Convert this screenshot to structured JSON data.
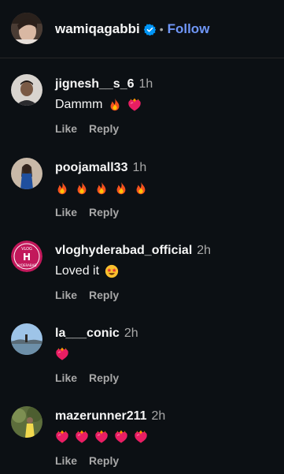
{
  "header": {
    "username": "wamiqagabbi",
    "separator": "•",
    "follow_label": "Follow",
    "verified_icon": "verified-badge-icon",
    "accent_color": "#6f96f7"
  },
  "comments": [
    {
      "username": "jignesh__s_6",
      "time": "1h",
      "text": "Dammm",
      "emojis": [
        "fire",
        "heart-on-fire"
      ],
      "like_label": "Like",
      "reply_label": "Reply"
    },
    {
      "username": "poojamall33",
      "time": "1h",
      "text": "",
      "emojis": [
        "fire",
        "fire",
        "fire",
        "fire",
        "fire"
      ],
      "like_label": "Like",
      "reply_label": "Reply"
    },
    {
      "username": "vloghyderabad_official",
      "time": "2h",
      "text": "Loved it",
      "emojis": [
        "star-struck"
      ],
      "like_label": "Like",
      "reply_label": "Reply"
    },
    {
      "username": "la___conic",
      "time": "2h",
      "text": "",
      "emojis": [
        "heart-on-fire"
      ],
      "like_label": "Like",
      "reply_label": "Reply"
    },
    {
      "username": "mazerunner211",
      "time": "2h",
      "text": "",
      "emojis": [
        "heart-on-fire",
        "heart-on-fire",
        "heart-on-fire",
        "heart-on-fire",
        "heart-on-fire"
      ],
      "like_label": "Like",
      "reply_label": "Reply"
    }
  ]
}
